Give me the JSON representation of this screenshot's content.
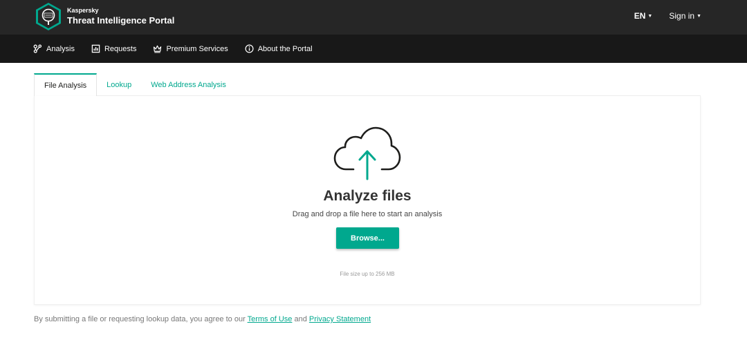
{
  "header": {
    "brand": "Kaspersky",
    "product": "Threat Intelligence Portal",
    "language": "EN",
    "sign_in": "Sign in"
  },
  "nav": {
    "items": [
      {
        "label": "Analysis",
        "icon": "analysis-icon"
      },
      {
        "label": "Requests",
        "icon": "requests-icon"
      },
      {
        "label": "Premium Services",
        "icon": "crown-icon"
      },
      {
        "label": "About the Portal",
        "icon": "info-icon"
      }
    ]
  },
  "tabs": [
    {
      "label": "File Analysis",
      "active": true
    },
    {
      "label": "Lookup",
      "active": false
    },
    {
      "label": "Web Address Analysis",
      "active": false
    }
  ],
  "upload": {
    "icon": "cloud-upload-icon",
    "title": "Analyze files",
    "subtitle": "Drag and drop a file here to start an analysis",
    "browse_label": "Browse...",
    "size_note": "File size up to 256 MB"
  },
  "footer": {
    "text_before": "By submitting a file or requesting lookup data, you agree to our ",
    "terms_link": "Terms of Use",
    "text_and": " and ",
    "privacy_link": "Privacy Statement"
  },
  "colors": {
    "accent": "#00a88e",
    "topbar": "#262626",
    "navbar": "#181818"
  }
}
